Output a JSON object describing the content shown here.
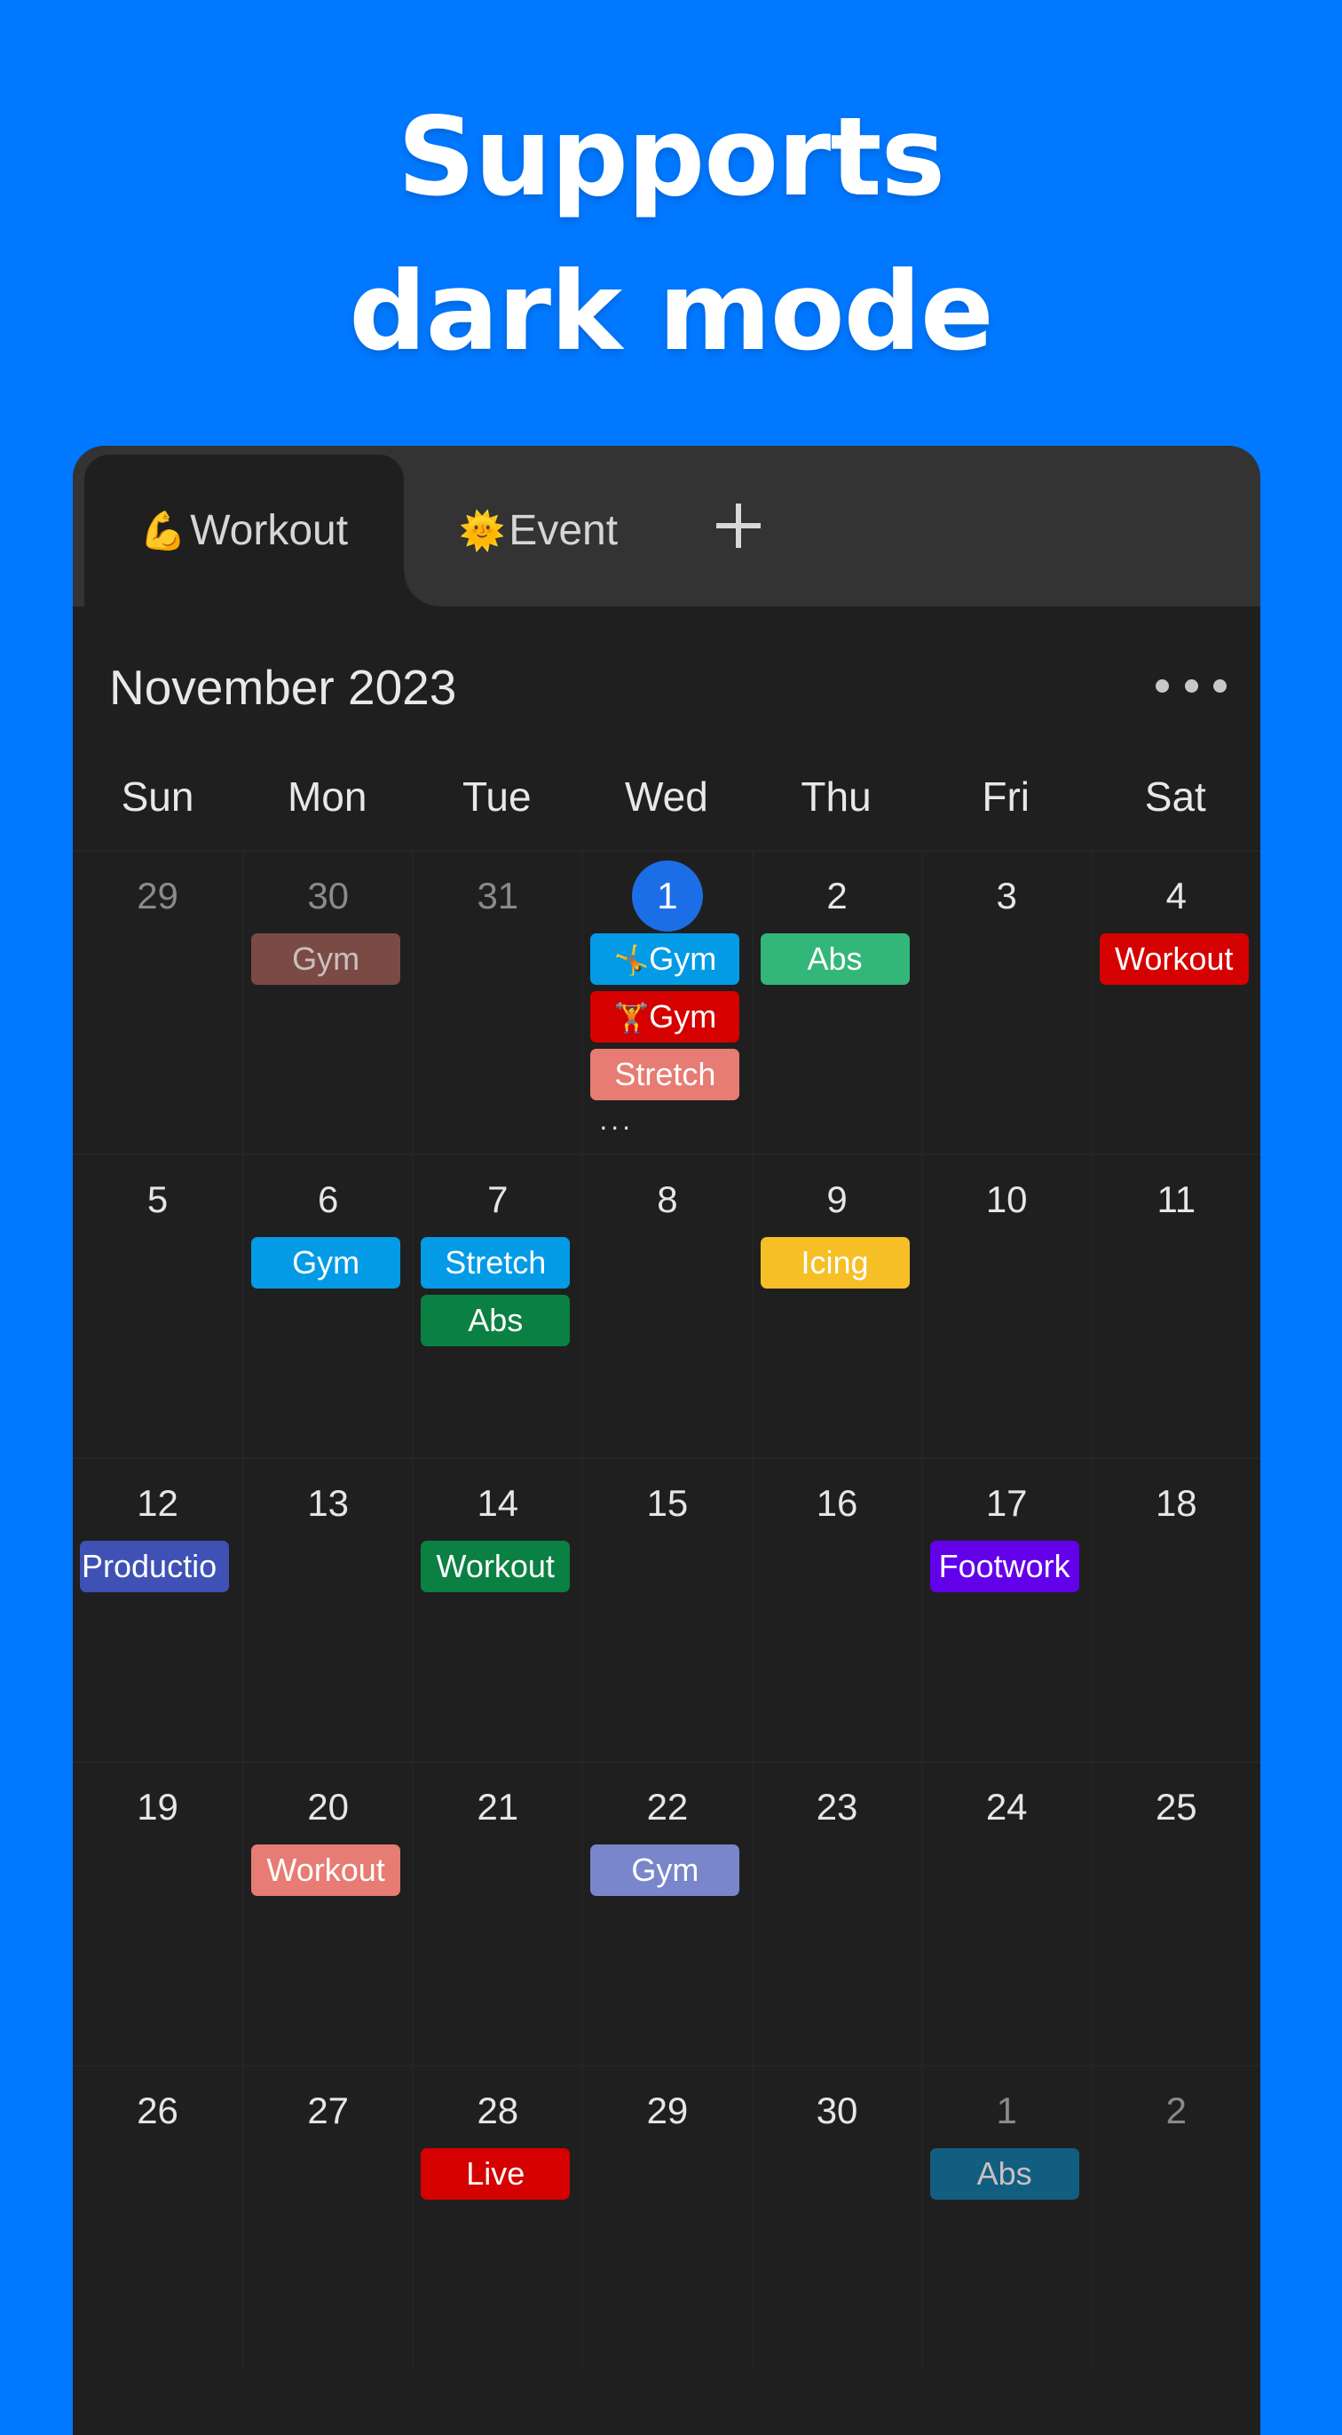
{
  "headline": {
    "line1": "Supports",
    "line2": "dark mode"
  },
  "colors": {
    "background": "#0078FF",
    "tabbar": "#333333",
    "calendar_bg": "#1F1F1F",
    "today_circle": "#1C6EE6"
  },
  "tabs": [
    {
      "emoji": "💪",
      "label": "Workout",
      "active": true
    },
    {
      "emoji": "🌞",
      "label": "Event",
      "active": false
    }
  ],
  "add_tab_icon": "plus-icon",
  "calendar": {
    "month_title": "November 2023",
    "more_icon": "more-horizontal-icon",
    "weekdays": [
      "Sun",
      "Mon",
      "Tue",
      "Wed",
      "Thu",
      "Fri",
      "Sat"
    ],
    "weeks": [
      [
        {
          "day": "29",
          "other": true,
          "events": []
        },
        {
          "day": "30",
          "other": true,
          "events": [
            {
              "label": "Gym",
              "color": "#7A4A45",
              "dim": true
            }
          ]
        },
        {
          "day": "31",
          "other": true,
          "events": []
        },
        {
          "day": "1",
          "today": true,
          "events": [
            {
              "emoji": "🤸",
              "label": "Gym",
              "color": "#039BE5"
            },
            {
              "emoji": "🏋️",
              "label": "Gym",
              "color": "#D50000"
            },
            {
              "label": "Stretch",
              "color": "#E67C73"
            }
          ],
          "more": "..."
        },
        {
          "day": "2",
          "events": [
            {
              "label": "Abs",
              "color": "#33B679"
            }
          ]
        },
        {
          "day": "3",
          "events": []
        },
        {
          "day": "4",
          "events": [
            {
              "label": "Workout",
              "color": "#D50000"
            }
          ]
        }
      ],
      [
        {
          "day": "5",
          "events": []
        },
        {
          "day": "6",
          "events": [
            {
              "label": "Gym",
              "color": "#039BE5"
            }
          ]
        },
        {
          "day": "7",
          "events": [
            {
              "label": "Stretch",
              "color": "#039BE5"
            },
            {
              "label": "Abs",
              "color": "#0B8043"
            }
          ]
        },
        {
          "day": "8",
          "events": []
        },
        {
          "day": "9",
          "events": [
            {
              "label": "Icing",
              "color": "#F6BF26"
            }
          ]
        },
        {
          "day": "10",
          "events": []
        },
        {
          "day": "11",
          "events": []
        }
      ],
      [
        {
          "day": "12",
          "events": [
            {
              "label": "Productio",
              "color": "#3F51B5",
              "clip": true
            }
          ]
        },
        {
          "day": "13",
          "events": []
        },
        {
          "day": "14",
          "events": [
            {
              "label": "Workout",
              "color": "#0B8043"
            }
          ]
        },
        {
          "day": "15",
          "events": []
        },
        {
          "day": "16",
          "events": []
        },
        {
          "day": "17",
          "events": [
            {
              "label": "Footwork",
              "color": "#6200EA"
            }
          ]
        },
        {
          "day": "18",
          "events": []
        }
      ],
      [
        {
          "day": "19",
          "events": []
        },
        {
          "day": "20",
          "events": [
            {
              "label": "Workout",
              "color": "#E67C73"
            }
          ]
        },
        {
          "day": "21",
          "events": []
        },
        {
          "day": "22",
          "events": [
            {
              "label": "Gym",
              "color": "#7986CB"
            }
          ]
        },
        {
          "day": "23",
          "events": []
        },
        {
          "day": "24",
          "events": []
        },
        {
          "day": "25",
          "events": []
        }
      ],
      [
        {
          "day": "26",
          "events": []
        },
        {
          "day": "27",
          "events": []
        },
        {
          "day": "28",
          "events": [
            {
              "label": "Live",
              "color": "#D50000"
            }
          ]
        },
        {
          "day": "29",
          "events": []
        },
        {
          "day": "30",
          "events": []
        },
        {
          "day": "1",
          "other": true,
          "events": [
            {
              "label": "Abs",
              "color": "#115E80",
              "dim": true
            }
          ]
        },
        {
          "day": "2",
          "other": true,
          "events": []
        }
      ]
    ]
  }
}
